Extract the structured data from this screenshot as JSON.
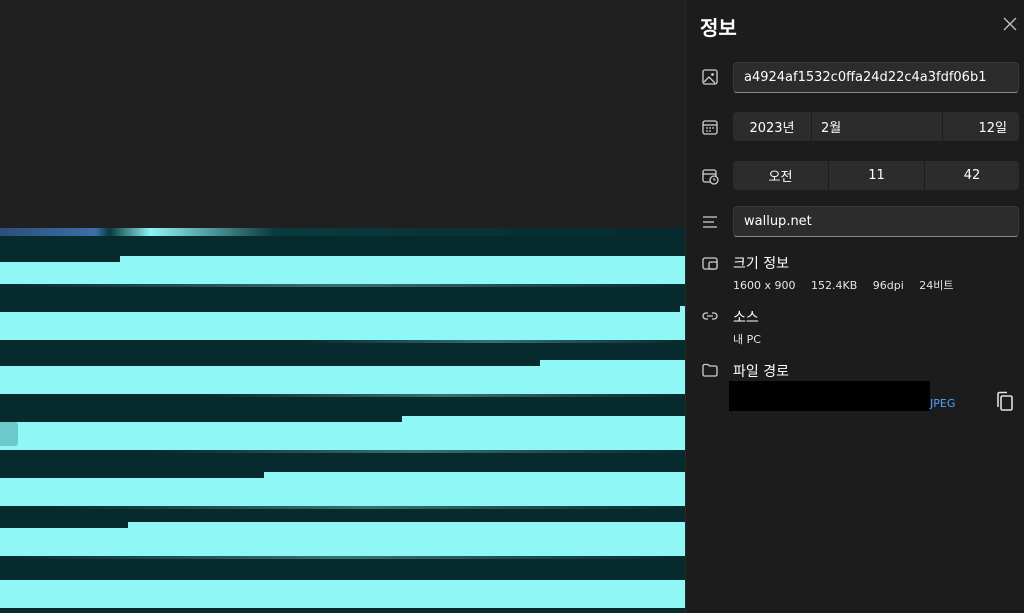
{
  "panel": {
    "title": "정보",
    "filename": "a4924af1532c0ffa24d22c4a3fdf06b1",
    "date": {
      "year": "2023년",
      "month": "2월",
      "day": "12일"
    },
    "time": {
      "ampm": "오전",
      "hour": "11",
      "minute": "42"
    },
    "description": "wallup.net",
    "size_info": {
      "title": "크기 정보",
      "resolution": "1600 x 900",
      "file_size": "152.4KB",
      "dpi": "96dpi",
      "bit_depth": "24비트"
    },
    "source": {
      "title": "소스",
      "value": "내 PC"
    },
    "file_path": {
      "title": "파일 경로",
      "extension": "JPEG"
    }
  },
  "icons": {
    "image": "image-icon",
    "calendar": "calendar-icon",
    "clock": "calendar-clock-icon",
    "description": "text-lines-icon",
    "size": "resize-icon",
    "source": "link-icon",
    "folder": "folder-icon",
    "copy": "copy-icon",
    "close": "close-icon"
  },
  "colors": {
    "panel_bg": "#1c1c1c",
    "field_bg": "#2c2c2c",
    "accent_link": "#4aa3ff",
    "image_stripe": "#8ff7f6",
    "image_dark": "#062a2e"
  }
}
